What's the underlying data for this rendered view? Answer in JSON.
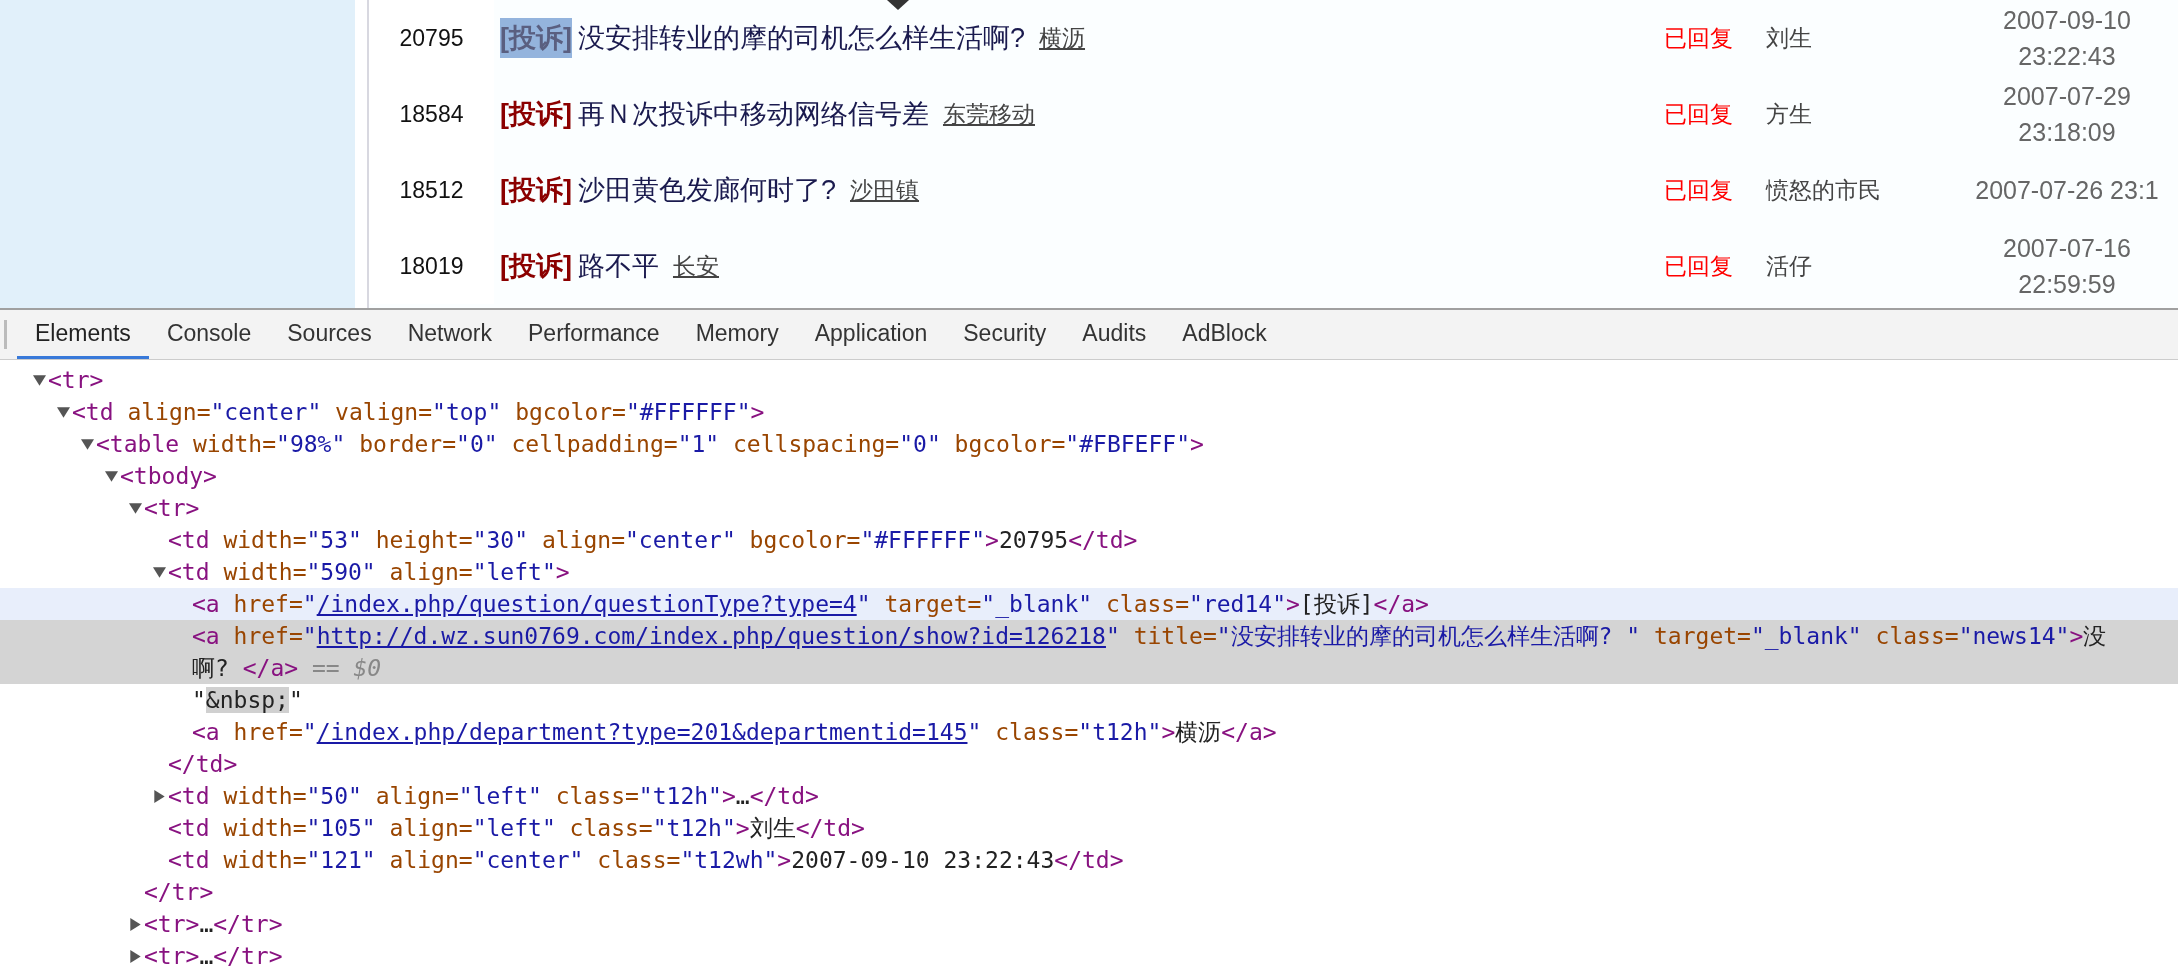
{
  "page": {
    "rows": [
      {
        "id": "20795",
        "category": "[投诉]",
        "category_highlighted": true,
        "title": "没安排转业的摩的司机怎么样生活啊?",
        "place": "横沥",
        "status": "已回复",
        "user": "刘生",
        "date_lines": [
          "2007-09-10",
          "23:22:43"
        ]
      },
      {
        "id": "18584",
        "category": "[投诉]",
        "category_highlighted": false,
        "title": "再Ｎ次投诉中移动网络信号差",
        "place": "东莞移动",
        "status": "已回复",
        "user": "方生",
        "date_lines": [
          "2007-07-29",
          "23:18:09"
        ]
      },
      {
        "id": "18512",
        "category": "[投诉]",
        "category_highlighted": false,
        "title": "沙田黄色发廊何时了?",
        "place": "沙田镇",
        "status": "已回复",
        "user": "愤怒的市民",
        "date_lines": [
          "2007-07-26 23:1"
        ]
      },
      {
        "id": "18019",
        "category": "[投诉]",
        "category_highlighted": false,
        "title": "路不平",
        "place": "长安",
        "status": "已回复",
        "user": "活仔",
        "date_lines": [
          "2007-07-16",
          "22:59:59"
        ]
      }
    ]
  },
  "devtools": {
    "tabs": [
      {
        "label": "Elements",
        "selected": true
      },
      {
        "label": "Console",
        "selected": false
      },
      {
        "label": "Sources",
        "selected": false
      },
      {
        "label": "Network",
        "selected": false
      },
      {
        "label": "Performance",
        "selected": false
      },
      {
        "label": "Memory",
        "selected": false
      },
      {
        "label": "Application",
        "selected": false
      },
      {
        "label": "Security",
        "selected": false
      },
      {
        "label": "Audits",
        "selected": false
      },
      {
        "label": "AdBlock",
        "selected": false
      }
    ],
    "tree": [
      {
        "expanded": true,
        "selected": false,
        "tokens": [
          {
            "tag": "<tr>"
          }
        ],
        "children": [
          {
            "expanded": true,
            "selected": false,
            "tokens": [
              {
                "tag": "<td"
              },
              {
                "attr": " align="
              },
              {
                "val": "\"center\""
              },
              {
                "attr": " valign="
              },
              {
                "val": "\"top\""
              },
              {
                "attr": " bgcolor="
              },
              {
                "val": "\"#FFFFFF\""
              },
              {
                "tag": ">"
              }
            ],
            "children": [
              {
                "expanded": true,
                "selected": false,
                "tokens": [
                  {
                    "tag": "<table"
                  },
                  {
                    "attr": " width="
                  },
                  {
                    "val": "\"98%\""
                  },
                  {
                    "attr": " border="
                  },
                  {
                    "val": "\"0\""
                  },
                  {
                    "attr": " cellpadding="
                  },
                  {
                    "val": "\"1\""
                  },
                  {
                    "attr": " cellspacing="
                  },
                  {
                    "val": "\"0\""
                  },
                  {
                    "attr": " bgcolor="
                  },
                  {
                    "val": "\"#FBFEFF\""
                  },
                  {
                    "tag": ">"
                  }
                ],
                "children": [
                  {
                    "expanded": true,
                    "selected": false,
                    "tokens": [
                      {
                        "tag": "<tbody>"
                      }
                    ],
                    "children": [
                      {
                        "expanded": true,
                        "selected": false,
                        "tokens": [
                          {
                            "tag": "<tr>"
                          }
                        ],
                        "children": [
                          {
                            "selected": false,
                            "tokens": [
                              {
                                "tag": "<td"
                              },
                              {
                                "attr": " width="
                              },
                              {
                                "val": "\"53\""
                              },
                              {
                                "attr": " height="
                              },
                              {
                                "val": "\"30\""
                              },
                              {
                                "attr": " align="
                              },
                              {
                                "val": "\"center\""
                              },
                              {
                                "attr": " bgcolor="
                              },
                              {
                                "val": "\"#FFFFFF\""
                              },
                              {
                                "tag": ">"
                              },
                              {
                                "text": "20795"
                              },
                              {
                                "tag": "</td>"
                              }
                            ]
                          },
                          {
                            "expanded": true,
                            "selected": false,
                            "tokens": [
                              {
                                "tag": "<td"
                              },
                              {
                                "attr": " width="
                              },
                              {
                                "val": "\"590\""
                              },
                              {
                                "attr": " align="
                              },
                              {
                                "val": "\"left\""
                              },
                              {
                                "tag": ">"
                              }
                            ],
                            "children": [
                              {
                                "selected": false,
                                "hovered": true,
                                "tokens": [
                                  {
                                    "tag": "<a"
                                  },
                                  {
                                    "attr": " href="
                                  },
                                  {
                                    "val": "\""
                                  },
                                  {
                                    "link": "/index.php/question/questionType?type=4"
                                  },
                                  {
                                    "val": "\""
                                  },
                                  {
                                    "attr": " target="
                                  },
                                  {
                                    "val": "\"_blank\""
                                  },
                                  {
                                    "attr": " class="
                                  },
                                  {
                                    "val": "\"red14\""
                                  },
                                  {
                                    "tag": ">"
                                  },
                                  {
                                    "text": "[投诉]"
                                  },
                                  {
                                    "tag": "</a>"
                                  }
                                ]
                              },
                              {
                                "selected": true,
                                "tokens": [
                                  {
                                    "tag": "<a"
                                  },
                                  {
                                    "attr": " href="
                                  },
                                  {
                                    "val": "\""
                                  },
                                  {
                                    "link": "http://d.wz.sun0769.com/index.php/question/show?id=126218"
                                  },
                                  {
                                    "val": "\""
                                  },
                                  {
                                    "attr": " title="
                                  },
                                  {
                                    "val": "\"没安排转业的摩的司机怎么样生活啊? \""
                                  },
                                  {
                                    "attr": " target="
                                  },
                                  {
                                    "val": "\"_blank\""
                                  },
                                  {
                                    "attr": " class="
                                  },
                                  {
                                    "val": "\"news14\""
                                  },
                                  {
                                    "tag": ">"
                                  },
                                  {
                                    "text": "没"
                                  }
                                ],
                                "continued": [
                                  {
                                    "text": "啊? "
                                  },
                                  {
                                    "tag": "</a>"
                                  },
                                  {
                                    "ref": " == $0"
                                  }
                                ]
                              },
                              {
                                "selected": false,
                                "tokens": [
                                  {
                                    "text": "\""
                                  },
                                  {
                                    "mark": "&nbsp;"
                                  },
                                  {
                                    "text": "\""
                                  }
                                ]
                              },
                              {
                                "selected": false,
                                "tokens": [
                                  {
                                    "tag": "<a"
                                  },
                                  {
                                    "attr": " href="
                                  },
                                  {
                                    "val": "\""
                                  },
                                  {
                                    "link": "/index.php/department?type=201&departmentid=145"
                                  },
                                  {
                                    "val": "\""
                                  },
                                  {
                                    "attr": " class="
                                  },
                                  {
                                    "val": "\"t12h\""
                                  },
                                  {
                                    "tag": ">"
                                  },
                                  {
                                    "text": "横沥"
                                  },
                                  {
                                    "tag": "</a>"
                                  }
                                ]
                              }
                            ],
                            "close": [
                              {
                                "tag": "</td>"
                              }
                            ]
                          },
                          {
                            "expanded": false,
                            "selected": false,
                            "tokens": [
                              {
                                "tag": "<td"
                              },
                              {
                                "attr": " width="
                              },
                              {
                                "val": "\"50\""
                              },
                              {
                                "attr": " align="
                              },
                              {
                                "val": "\"left\""
                              },
                              {
                                "attr": " class="
                              },
                              {
                                "val": "\"t12h\""
                              },
                              {
                                "tag": ">"
                              },
                              {
                                "text": "…"
                              },
                              {
                                "tag": "</td>"
                              }
                            ]
                          },
                          {
                            "selected": false,
                            "tokens": [
                              {
                                "tag": "<td"
                              },
                              {
                                "attr": " width="
                              },
                              {
                                "val": "\"105\""
                              },
                              {
                                "attr": " align="
                              },
                              {
                                "val": "\"left\""
                              },
                              {
                                "attr": " class="
                              },
                              {
                                "val": "\"t12h\""
                              },
                              {
                                "tag": ">"
                              },
                              {
                                "text": "刘生"
                              },
                              {
                                "tag": "</td>"
                              }
                            ]
                          },
                          {
                            "selected": false,
                            "tokens": [
                              {
                                "tag": "<td"
                              },
                              {
                                "attr": " width="
                              },
                              {
                                "val": "\"121\""
                              },
                              {
                                "attr": " align="
                              },
                              {
                                "val": "\"center\""
                              },
                              {
                                "attr": " class="
                              },
                              {
                                "val": "\"t12wh\""
                              },
                              {
                                "tag": ">"
                              },
                              {
                                "text": "2007-09-10 23:22:43"
                              },
                              {
                                "tag": "</td>"
                              }
                            ]
                          }
                        ],
                        "close": [
                          {
                            "tag": "</tr>"
                          }
                        ]
                      },
                      {
                        "expanded": false,
                        "selected": false,
                        "tokens": [
                          {
                            "tag": "<tr>"
                          },
                          {
                            "text": "…"
                          },
                          {
                            "tag": "</tr>"
                          }
                        ]
                      },
                      {
                        "expanded": false,
                        "selected": false,
                        "tokens": [
                          {
                            "tag": "<tr>"
                          },
                          {
                            "text": "…"
                          },
                          {
                            "tag": "</tr>"
                          }
                        ]
                      }
                    ]
                  }
                ]
              }
            ]
          }
        ]
      }
    ]
  }
}
